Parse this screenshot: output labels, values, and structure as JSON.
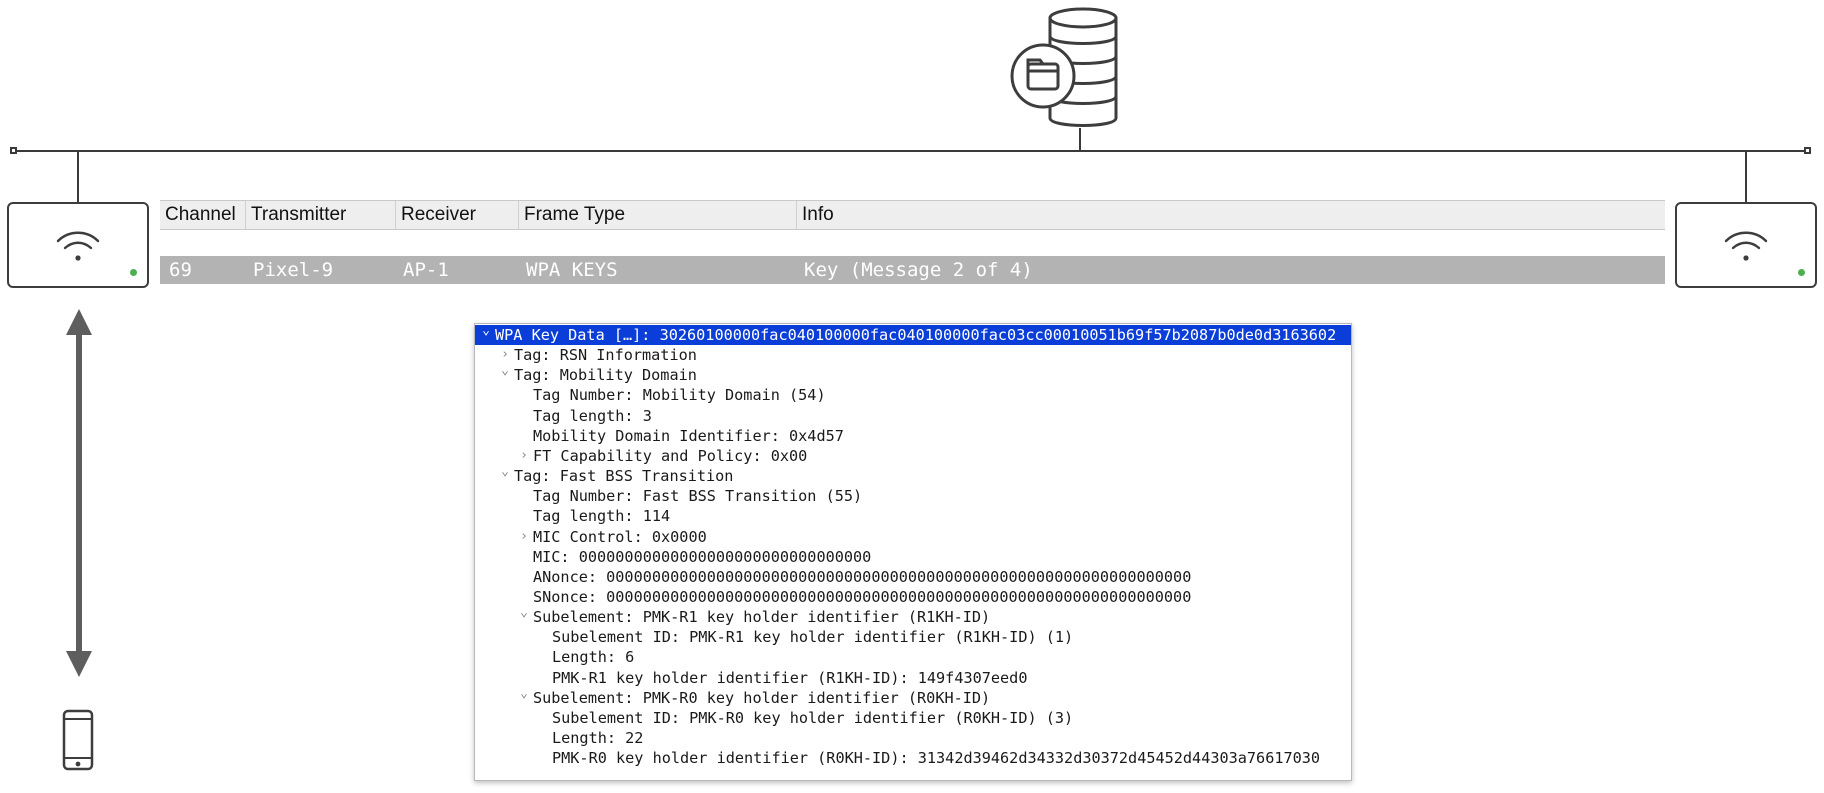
{
  "packet_list": {
    "columns": [
      "Channel",
      "Transmitter",
      "Receiver",
      "Frame Type",
      "Info"
    ],
    "row": {
      "channel": "69",
      "transmitter": "Pixel-9",
      "receiver": "AP-1",
      "frame_type": "WPA KEYS",
      "info": "Key (Message 2 of 4)"
    }
  },
  "tree": [
    {
      "text": "WPA Key Data […]: 30260100000fac040100000fac040100000fac03cc00010051b69f57b2087b0de0d3163602",
      "depth": 0,
      "toggle": "expanded",
      "selected": true
    },
    {
      "text": "Tag: RSN Information",
      "depth": 1,
      "toggle": "collapsed"
    },
    {
      "text": "Tag: Mobility Domain",
      "depth": 1,
      "toggle": "expanded"
    },
    {
      "text": "Tag Number: Mobility Domain (54)",
      "depth": 2,
      "toggle": "none"
    },
    {
      "text": "Tag length: 3",
      "depth": 2,
      "toggle": "none"
    },
    {
      "text": "Mobility Domain Identifier: 0x4d57",
      "depth": 2,
      "toggle": "none"
    },
    {
      "text": "FT Capability and Policy: 0x00",
      "depth": 2,
      "toggle": "collapsed"
    },
    {
      "text": "Tag: Fast BSS Transition",
      "depth": 1,
      "toggle": "expanded"
    },
    {
      "text": "Tag Number: Fast BSS Transition (55)",
      "depth": 2,
      "toggle": "none"
    },
    {
      "text": "Tag length: 114",
      "depth": 2,
      "toggle": "none"
    },
    {
      "text": "MIC Control: 0x0000",
      "depth": 2,
      "toggle": "collapsed"
    },
    {
      "text": "MIC: 00000000000000000000000000000000",
      "depth": 2,
      "toggle": "none"
    },
    {
      "text": "ANonce: 0000000000000000000000000000000000000000000000000000000000000000",
      "depth": 2,
      "toggle": "none"
    },
    {
      "text": "SNonce: 0000000000000000000000000000000000000000000000000000000000000000",
      "depth": 2,
      "toggle": "none"
    },
    {
      "text": "Subelement: PMK-R1 key holder identifier (R1KH-ID)",
      "depth": 2,
      "toggle": "expanded"
    },
    {
      "text": "Subelement ID: PMK-R1 key holder identifier (R1KH-ID) (1)",
      "depth": 3,
      "toggle": "none"
    },
    {
      "text": "Length: 6",
      "depth": 3,
      "toggle": "none"
    },
    {
      "text": "PMK-R1 key holder identifier (R1KH-ID): 149f4307eed0",
      "depth": 3,
      "toggle": "none"
    },
    {
      "text": "Subelement: PMK-R0 key holder identifier (R0KH-ID)",
      "depth": 2,
      "toggle": "expanded"
    },
    {
      "text": "Subelement ID: PMK-R0 key holder identifier (R0KH-ID) (3)",
      "depth": 3,
      "toggle": "none"
    },
    {
      "text": "Length: 22",
      "depth": 3,
      "toggle": "none"
    },
    {
      "text": "PMK-R0 key holder identifier (R0KH-ID): 31342d39462d34332d30372d45452d44303a76617030",
      "depth": 3,
      "toggle": "none"
    }
  ],
  "icons": {
    "server": "database-icon",
    "ap_left": "wifi-icon",
    "ap_right": "wifi-icon",
    "client": "smartphone-icon",
    "link": "double-arrow-icon"
  },
  "colors": {
    "selection": "#0b3ed8",
    "row_highlight": "#b3b3b3",
    "led": "#4caf50",
    "line": "#3a3a3a"
  }
}
